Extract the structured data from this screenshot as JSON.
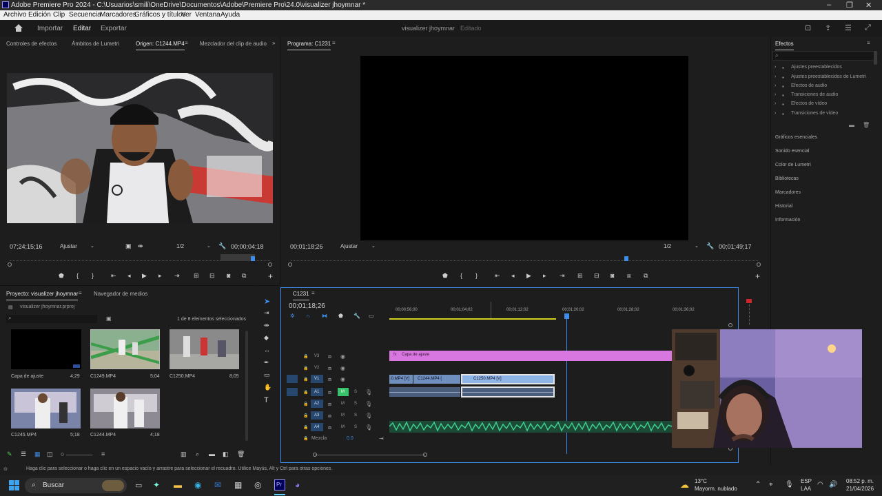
{
  "window": {
    "title": "Adobe Premiere Pro 2024 - C:\\Usuarios\\smili\\OneDrive\\Documentos\\Adobe\\Premiere Pro\\24.0\\visualizer jhoymnar *",
    "minimize": "–",
    "maximize": "❐",
    "close": "✕"
  },
  "menu": [
    "Archivo",
    "Edición",
    "Clip",
    "Secuencia",
    "Marcadores",
    "Gráficos y títulos",
    "Ver",
    "Ventana",
    "Ayuda"
  ],
  "header": {
    "tabs": [
      "Importar",
      "Editar",
      "Exportar"
    ],
    "project_name": "visualizer jhoymnar",
    "status": "Editado"
  },
  "source_panel": {
    "tabs": [
      "Controles de efectos",
      "Ámbitos de Lumetri",
      "Origen: C1244.MP4",
      "Mezclador del clip de audio"
    ],
    "timecode": "07;24;15;16",
    "fit": "Ajustar",
    "resolution": "1/2",
    "duration": "00;00;04;18"
  },
  "program_panel": {
    "tab": "Programa: C1231",
    "timecode": "00;01;18;26",
    "fit": "Ajustar",
    "resolution": "1/2",
    "duration": "00;01;49;17"
  },
  "project_panel": {
    "tabs": [
      "Proyecto: visualizer jhoymnar",
      "Navegador de medios"
    ],
    "file": "visualizer jhoymnar.prproj",
    "selection": "1 de 8 elementos seleccionados",
    "items": [
      {
        "name": "Capa de ajuste",
        "duration": "4;29"
      },
      {
        "name": "C1249.MP4",
        "duration": "5;04"
      },
      {
        "name": "C1250.MP4",
        "duration": "8;05"
      },
      {
        "name": "C1245.MP4",
        "duration": "5;18"
      },
      {
        "name": "C1244.MP4",
        "duration": "4;18"
      }
    ]
  },
  "timeline": {
    "tab": "C1231",
    "timecode": "00;01;18;26",
    "ruler": [
      "00;00;56;00",
      "00;01;04;02",
      "00;01;12;02",
      "00;01;20;02",
      "00;01;28;02",
      "00;01;36;02"
    ],
    "tracks": [
      "V3",
      "V2",
      "V1",
      "A1",
      "A2",
      "A3",
      "A4"
    ],
    "mix_label": "Mezcla",
    "mix_value": "0.0",
    "clips": {
      "adjust": "Capa de ajuste",
      "v1a": ".0.MP4 [V]",
      "v1b": "C1244.MP4 [",
      "v1c": "C1250.MP4 [V]"
    }
  },
  "effects_panel": {
    "title": "Efectos",
    "items": [
      "Ajustes preestablecidos",
      "Ajustes preestablecidos de Lumetri",
      "Efectos de audio",
      "Transiciones de audio",
      "Efectos de vídeo",
      "Transiciones de vídeo"
    ],
    "panels": [
      "Gráficos esenciales",
      "Sonido esencial",
      "Color de Lumetri",
      "Bibliotecas",
      "Marcadores",
      "Historial",
      "Información"
    ]
  },
  "status": "Haga clic para seleccionar o haga clic en un espacio vacío y arrastre para seleccionar el recuadro. Utilice Mayús, Alt y Ctrl para otras opciones.",
  "taskbar": {
    "search": "Buscar",
    "weather_temp": "13°C",
    "weather_desc": "Mayorm. nublado",
    "lang": "ESP",
    "lang2": "LAA",
    "time": "08:52 p. m.",
    "date": "21/04/2026"
  },
  "colors": {
    "accent": "#3e8ee9",
    "adjust_clip": "#d977e0",
    "video_clip": "#8fb4e6",
    "audio_wave": "#3ecf8e"
  }
}
